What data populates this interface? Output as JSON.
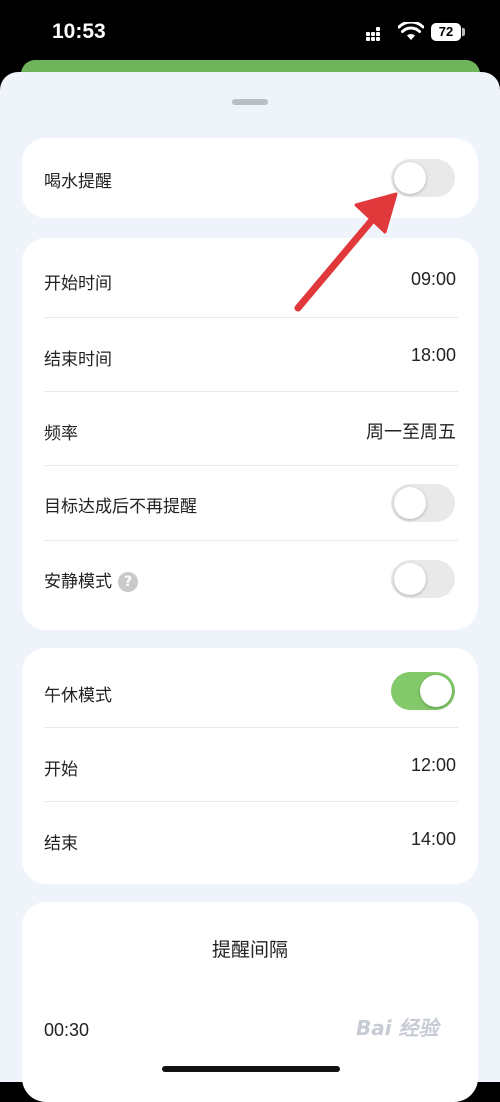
{
  "status_bar": {
    "time": "10:53",
    "battery": "72"
  },
  "water_reminder": {
    "label": "喝水提醒",
    "enabled": false
  },
  "schedule": {
    "start_time": {
      "label": "开始时间",
      "value": "09:00"
    },
    "end_time": {
      "label": "结束时间",
      "value": "18:00"
    },
    "frequency": {
      "label": "频率",
      "value": "周一至周五"
    },
    "stop_when_goal_met": {
      "label": "目标达成后不再提醒",
      "enabled": false
    },
    "quiet_mode": {
      "label": "安静模式",
      "help": "?",
      "enabled": false
    }
  },
  "nap_mode": {
    "label": "午休模式",
    "enabled": true,
    "start": {
      "label": "开始",
      "value": "12:00"
    },
    "end": {
      "label": "结束",
      "value": "14:00"
    }
  },
  "interval": {
    "title": "提醒间隔",
    "value": "00:30"
  },
  "watermark": "Bai 经验",
  "colors": {
    "accent_green": "#82c96a",
    "sheet_bg": "#eff4fb",
    "arrow_red": "#e0383b"
  }
}
